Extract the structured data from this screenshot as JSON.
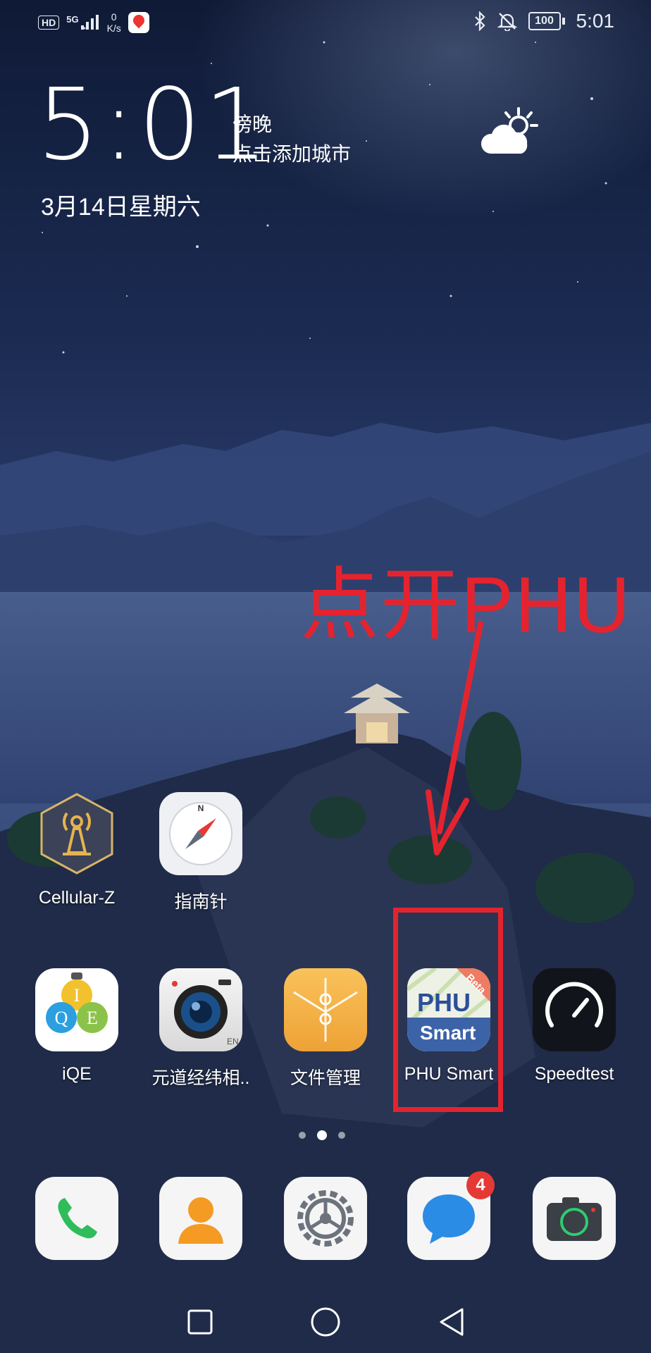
{
  "status_bar": {
    "hd": "HD",
    "network": "5G",
    "speed_value": "0",
    "speed_unit": "K/s",
    "battery": "100",
    "time": "5:01",
    "icons": [
      "bluetooth-icon",
      "mute-icon",
      "battery-icon"
    ]
  },
  "clock_widget": {
    "time": "5:01",
    "period": "傍晚",
    "add_city": "点击添加城市",
    "date": "3月14日星期六",
    "weather_icon": "partly-cloudy-icon"
  },
  "annotation": {
    "text": "点开PHU",
    "color": "#e5232f"
  },
  "apps_row1": [
    {
      "label": "Cellular-Z",
      "icon": "cellular-z-icon"
    },
    {
      "label": "指南针",
      "icon": "compass-icon"
    }
  ],
  "apps_row2": [
    {
      "label": "iQE",
      "icon": "iqe-icon"
    },
    {
      "label": "元道经纬相..",
      "icon": "camera-lens-icon"
    },
    {
      "label": "文件管理",
      "icon": "folder-icon"
    },
    {
      "label": "PHU Smart",
      "icon": "phu-smart-icon",
      "icon_top": "PHU",
      "icon_bottom": "Smart",
      "ribbon": "Beta"
    },
    {
      "label": "Speedtest",
      "icon": "speedtest-icon"
    }
  ],
  "page_indicator": {
    "pages": 3,
    "active": 2
  },
  "dock": [
    {
      "name": "phone",
      "icon": "phone-icon"
    },
    {
      "name": "contacts",
      "icon": "contacts-icon"
    },
    {
      "name": "settings",
      "icon": "settings-icon"
    },
    {
      "name": "messages",
      "icon": "messages-icon",
      "badge": "4"
    },
    {
      "name": "camera",
      "icon": "camera-icon"
    }
  ],
  "navigation": [
    "recents-button",
    "home-button",
    "back-button"
  ]
}
